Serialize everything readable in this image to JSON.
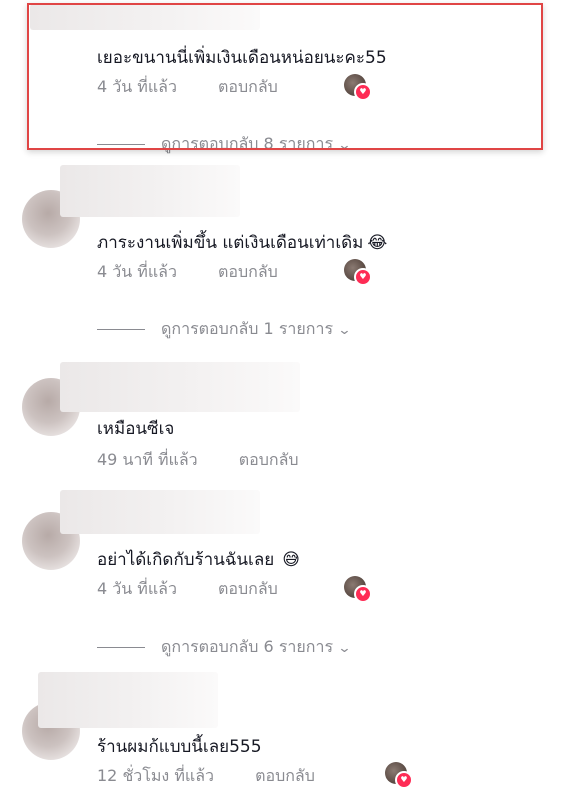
{
  "colors": {
    "accent": "#fe2c55",
    "highlight": "#e04545",
    "meta": "#8a8b91",
    "text": "#161823"
  },
  "comments": [
    {
      "text": "เยอะขนานนี่เพิ่มเงินเดือนหน่อยนะคะ55",
      "emoji": "",
      "time": "4 วัน ที่แล้ว",
      "reply_label": "ตอบกลับ",
      "creator_liked": true,
      "view_replies": "ดูการตอบกลับ 8 รายการ"
    },
    {
      "text": "ภาระงานเพิ่มขึ้น แต่เงินเดือนเท่าเดิม",
      "emoji": "😂",
      "time": "4 วัน ที่แล้ว",
      "reply_label": "ตอบกลับ",
      "creator_liked": true,
      "view_replies": "ดูการตอบกลับ 1 รายการ"
    },
    {
      "text": "เหมือนซีเจ",
      "emoji": "",
      "time": "49 นาที ที่แล้ว",
      "reply_label": "ตอบกลับ",
      "creator_liked": false,
      "view_replies": ""
    },
    {
      "text": "อย่าได้เกิดกับร้านฉันเลย",
      "emoji": "😅",
      "time": "4 วัน ที่แล้ว",
      "reply_label": "ตอบกลับ",
      "creator_liked": true,
      "view_replies": "ดูการตอบกลับ 6 รายการ"
    },
    {
      "text": "ร้านผมก้แบบนี้เลย555",
      "emoji": "",
      "time": "12 ชั่วโมง ที่แล้ว",
      "reply_label": "ตอบกลับ",
      "creator_liked": true,
      "view_replies": ""
    }
  ]
}
